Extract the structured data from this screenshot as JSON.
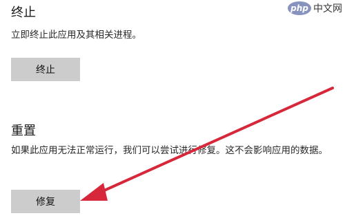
{
  "terminate": {
    "heading": "终止",
    "description": "立即终止此应用及其相关进程。",
    "button_label": "终止"
  },
  "reset": {
    "heading": "重置",
    "description": "如果此应用无法正常运行，我们可以尝试进行修复。这不会影响应用的数据。",
    "button_label": "修复"
  },
  "watermark": {
    "logo": "php",
    "text": "中文网"
  },
  "annotation": {
    "arrow_color": "#d6283a"
  }
}
